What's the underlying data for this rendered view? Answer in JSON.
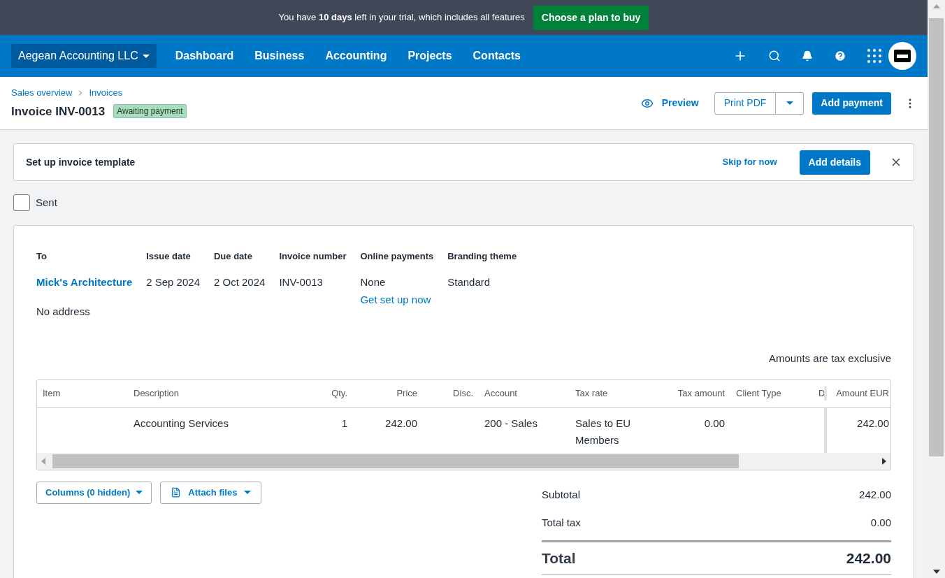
{
  "trial_banner": {
    "message": "You have **10 days** left in your trial, which includes all features",
    "button": "Choose a plan to buy"
  },
  "nav": {
    "org": "Aegean Accounting LLC",
    "items": [
      {
        "label": "Dashboard"
      },
      {
        "label": "Business"
      },
      {
        "label": "Accounting"
      },
      {
        "label": "Projects"
      },
      {
        "label": "Contacts"
      }
    ]
  },
  "breadcrumbs": [
    "Sales overview",
    "Invoices"
  ],
  "page_title": "Invoice INV-0013",
  "status_badge": "Awaiting payment",
  "actions": {
    "preview": "Preview",
    "print": "Print PDF",
    "add_payment": "Add payment"
  },
  "template_card": {
    "title": "Set up invoice template",
    "skip": "Skip for now",
    "add": "Add details"
  },
  "sent": {
    "label": "Sent",
    "checked": false
  },
  "details": [
    {
      "heading": "To",
      "value": "Mick's Architecture",
      "kind": "contact",
      "extra": "No address"
    },
    {
      "heading": "Issue date",
      "value": "2 Sep 2024",
      "kind": "text"
    },
    {
      "heading": "Due date",
      "value": "2 Oct 2024",
      "kind": "text"
    },
    {
      "heading": "Invoice number",
      "value": "INV-0013",
      "kind": "text"
    },
    {
      "heading": "Online payments",
      "value": "None",
      "kind": "text",
      "link": "Get set up now"
    },
    {
      "heading": "Branding theme",
      "value": "Standard",
      "kind": "text"
    }
  ],
  "tax_note": "Amounts are tax exclusive",
  "table": {
    "columns": [
      "Item",
      "Description",
      "Qty.",
      "Price",
      "Disc.",
      "Account",
      "Tax rate",
      "Tax amount",
      "Client Type",
      "D",
      "Amount EUR"
    ],
    "rows": [
      [
        "",
        "Accounting Services",
        "1",
        "242.00",
        "",
        "200 - Sales",
        "Sales to EU Members",
        "0.00",
        "",
        "",
        "242.00"
      ]
    ]
  },
  "table_buttons": {
    "columns": "Columns (0 hidden)",
    "attach": "Attach files"
  },
  "totals": [
    {
      "label": "Subtotal",
      "value": "242.00"
    },
    {
      "label": "Total tax",
      "value": "0.00"
    }
  ],
  "total": {
    "label": "Total",
    "value": "242.00"
  }
}
